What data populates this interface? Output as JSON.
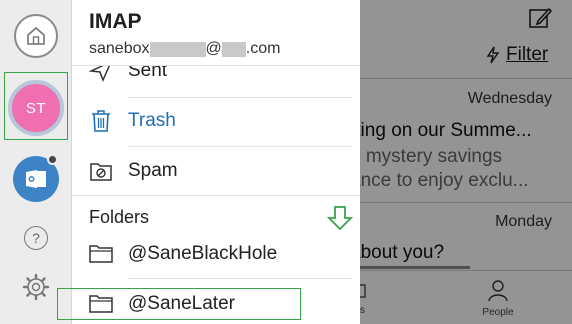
{
  "account": {
    "title": "IMAP",
    "email_prefix": "sanebox",
    "email_at": "@",
    "email_suffix": ".com"
  },
  "rail": {
    "avatar_initials": "ST",
    "help_glyph": "?",
    "icons": [
      "home-icon",
      "outlook-icon",
      "help-icon",
      "gear-icon"
    ]
  },
  "mailboxes": [
    {
      "label": "Sent",
      "icon": "paper-plane-icon"
    },
    {
      "label": "Trash",
      "icon": "trash-icon"
    },
    {
      "label": "Spam",
      "icon": "spam-folder-icon"
    }
  ],
  "folders_header": "Folders",
  "folders": [
    {
      "label": "@SaneBlackHole",
      "icon": "folder-icon"
    },
    {
      "label": "@SaneLater",
      "icon": "folder-icon"
    }
  ],
  "background": {
    "filter_label": "Filter",
    "messages": [
      {
        "day": "Wednesday",
        "subject": "tting on our Summe...",
        "preview1": "e mystery savings",
        "preview2": "ance to enjoy exclu..."
      },
      {
        "day": "Monday",
        "subject": "about you?"
      }
    ],
    "tabs": {
      "people_label": "People",
      "partial_label": "s"
    }
  },
  "colors": {
    "highlight_green": "#39a349",
    "avatar_pink": "#ef6fb1",
    "outlook_blue": "#3d84c6",
    "trash_blue": "#1f6fb8"
  }
}
